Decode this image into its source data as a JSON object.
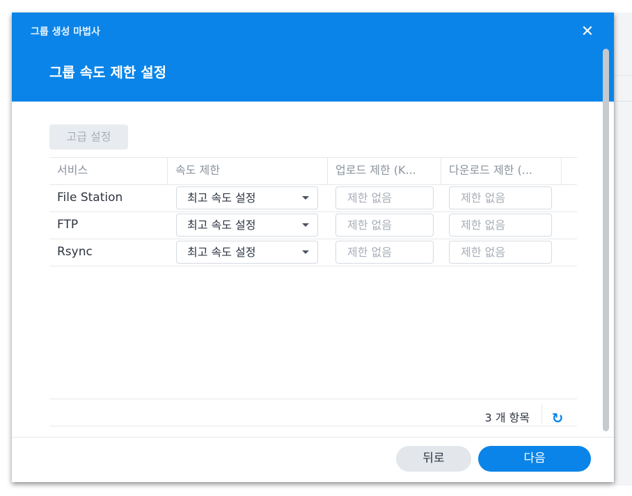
{
  "wizard_title": "그룹 생성 마법사",
  "step_title": "그룹 속도 제한 설정",
  "advanced_button": "고급 설정",
  "columns": [
    "서비스",
    "속도 제한",
    "업로드 제한 (K...",
    "다운로드 제한 (..."
  ],
  "rows": [
    {
      "service": "File Station",
      "limit_mode": "최고 속도 설정",
      "upload_placeholder": "제한 없음",
      "download_placeholder": "제한 없음"
    },
    {
      "service": "FTP",
      "limit_mode": "최고 속도 설정",
      "upload_placeholder": "제한 없음",
      "download_placeholder": "제한 없음"
    },
    {
      "service": "Rsync",
      "limit_mode": "최고 속도 설정",
      "upload_placeholder": "제한 없음",
      "download_placeholder": "제한 없음"
    }
  ],
  "item_count": "3 개 항목",
  "buttons": {
    "back": "뒤로",
    "next": "다음"
  },
  "icons": {
    "close": "close-icon",
    "refresh": "refresh-icon",
    "dropdown": "caret-down-icon"
  },
  "colors": {
    "header": "#0a84e8",
    "primary_button": "#0a84e8"
  }
}
